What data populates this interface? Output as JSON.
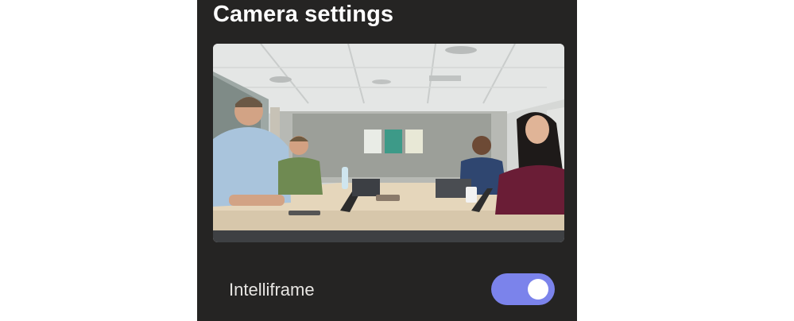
{
  "header": {
    "title": "Camera settings"
  },
  "camera": {
    "preview_alt": "Camera preview",
    "icon": "camera-preview-image"
  },
  "settings": {
    "intelliframe": {
      "label": "Intelliframe",
      "enabled": true
    }
  },
  "colors": {
    "panel_background": "#252423",
    "toggle_on": "#7b83eb",
    "text_primary": "#ffffff"
  }
}
